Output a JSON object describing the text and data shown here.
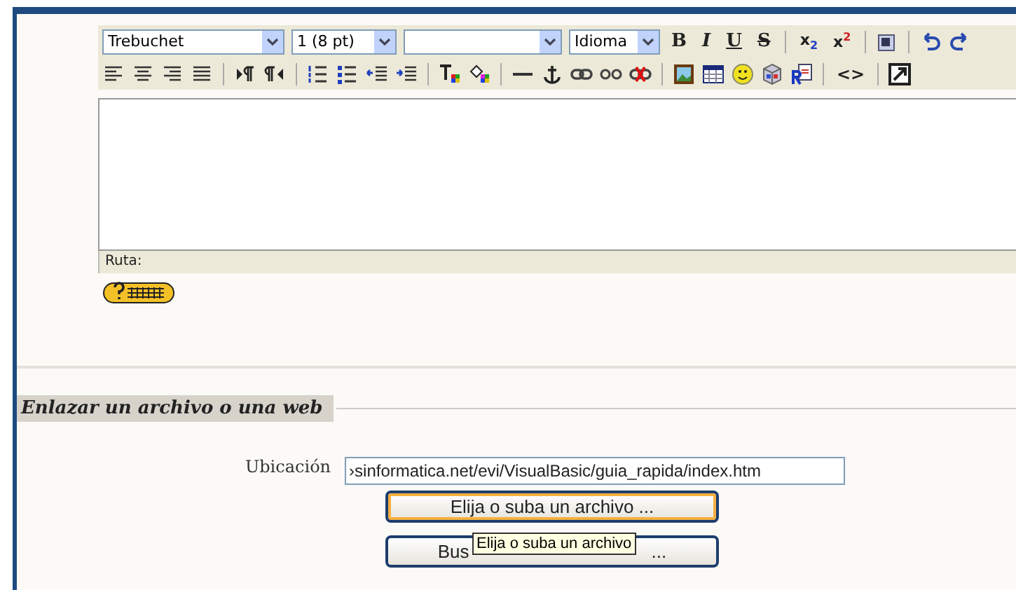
{
  "editor": {
    "font": "Trebuchet",
    "size": "1 (8 pt)",
    "language": "Idioma",
    "format_buttons": [
      "B",
      "I",
      "U",
      "S"
    ],
    "script_buttons": [
      {
        "base": "x",
        "mark": "2",
        "kind": "sub"
      },
      {
        "base": "x",
        "mark": "2",
        "kind": "sup"
      }
    ],
    "code_button": "<>",
    "path_label": "Ruta:"
  },
  "section": {
    "title": "Enlazar un archivo o una web",
    "location_label": "Ubicación",
    "location_value": "›sinformatica.net/evi/VisualBasic/guia_rapida/index.htm",
    "buttons": [
      {
        "label": "Elija o suba un archivo ...",
        "selected": true
      },
      {
        "label": "Bus",
        "label_end": "...",
        "selected": false
      }
    ],
    "tooltip": "Elija o suba un archivo"
  }
}
